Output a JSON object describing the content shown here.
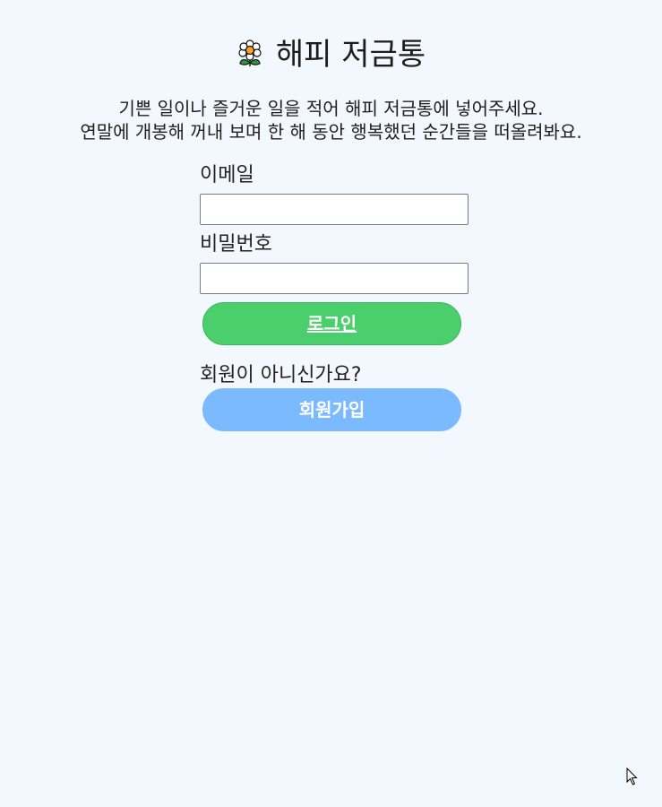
{
  "header": {
    "title": "해피 저금통",
    "logo_icon": "flower-icon"
  },
  "intro": {
    "line1": "기쁜 일이나 즐거운 일을 적어 해피 저금통에 넣어주세요.",
    "line2": "연말에 개봉해 꺼내 보며 한 해 동안 행복했던 순간들을 떠올려봐요."
  },
  "login_form": {
    "email_label": "이메일",
    "email_value": "",
    "password_label": "비밀번호",
    "password_value": "",
    "login_button": "로그인"
  },
  "signup": {
    "prompt": "회원이 아니신가요?",
    "button": "회원가입"
  },
  "colors": {
    "background": "#f3f8ff",
    "login_button": "#4bce6c",
    "signup_button": "#7cbaff"
  }
}
